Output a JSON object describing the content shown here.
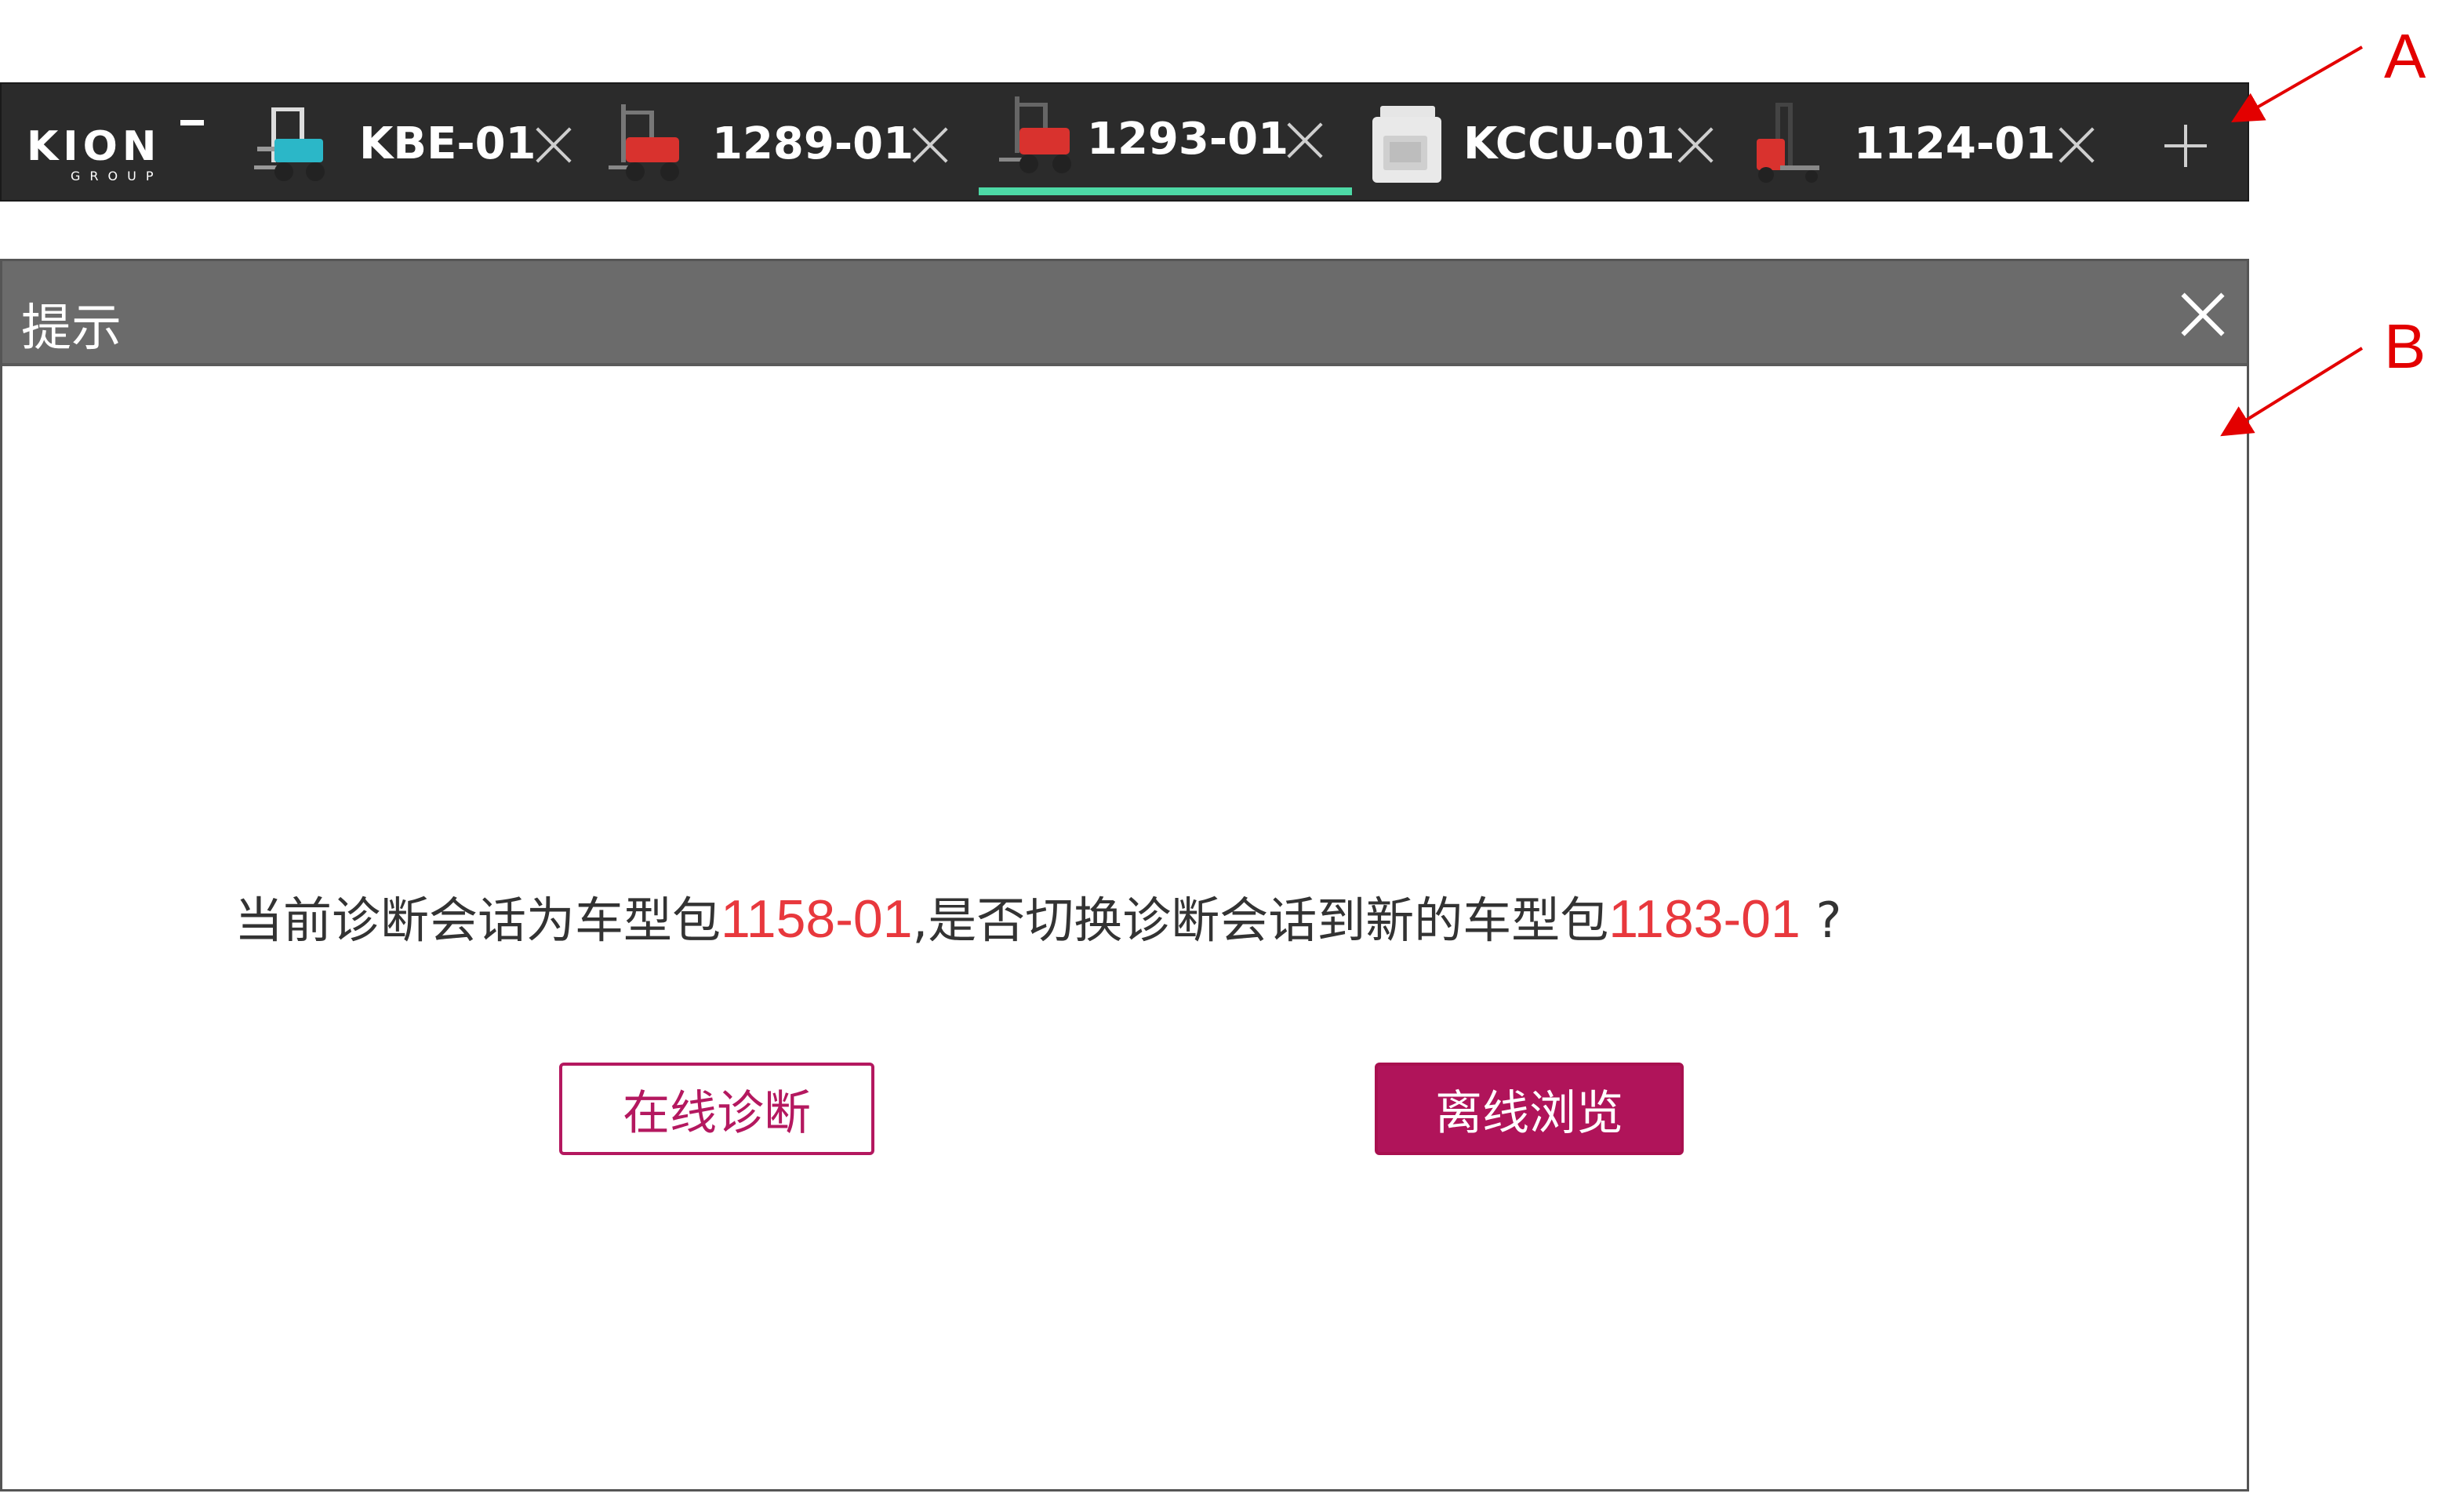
{
  "tabbar": {
    "logo": {
      "text": "KION",
      "sub": "GROUP"
    },
    "tabs": [
      {
        "label": "KBE-01",
        "icon": "forklift-teal-icon"
      },
      {
        "label": "1289-01",
        "icon": "forklift-red-icon"
      },
      {
        "label": "1293-01",
        "icon": "forklift-red-icon",
        "active": true
      },
      {
        "label": "KCCU-01",
        "icon": "control-unit-icon"
      },
      {
        "label": "1124-01",
        "icon": "reach-truck-icon"
      }
    ],
    "add_label": "+"
  },
  "dialog": {
    "title": "提示",
    "message": {
      "part1": "当前诊断会话为车型包",
      "current_pkg": "1158-01",
      "part2": ",是否切换诊断会话到新的车型包",
      "new_pkg": "1183-01",
      "part3": " ?"
    },
    "buttons": {
      "online": "在线诊断",
      "offline": "离线浏览"
    }
  },
  "annotations": {
    "a": "A",
    "b": "B"
  },
  "colors": {
    "tabbar_bg": "#2b2b2b",
    "active_underline": "#4dd9a6",
    "header_bg": "#6b6b6b",
    "package_text": "#e8383d",
    "brand_magenta": "#b0145a",
    "annotation": "#e30000"
  }
}
